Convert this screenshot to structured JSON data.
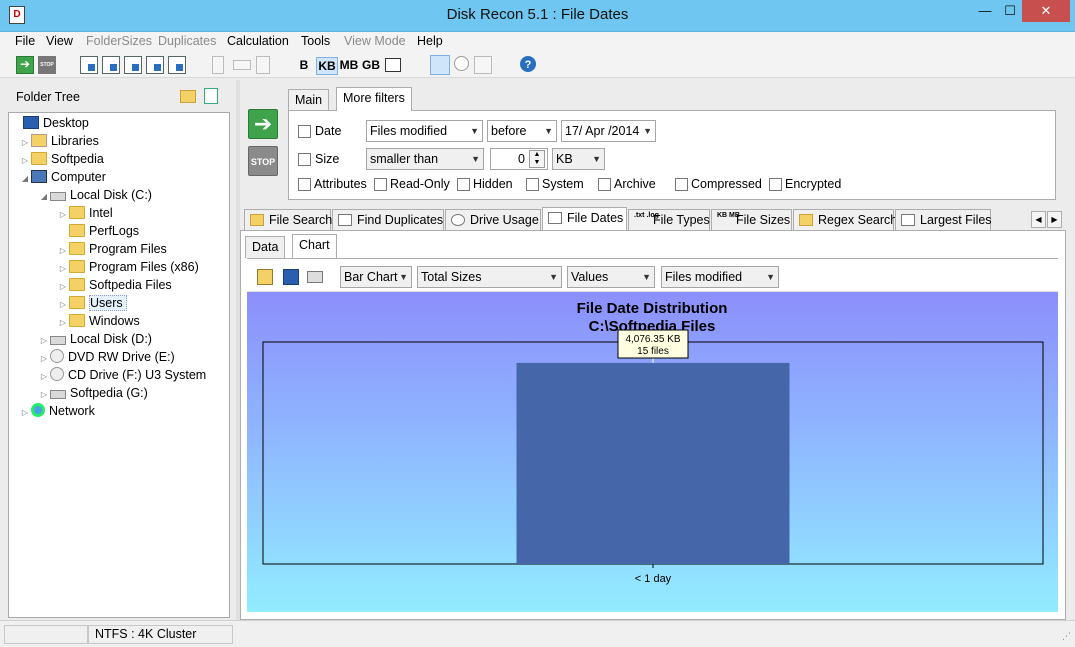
{
  "window": {
    "title": "Disk Recon 5.1 : File Dates",
    "minimize": "—",
    "maximize": "☐",
    "close": "✕"
  },
  "menu": [
    {
      "label": "File",
      "disabled": false
    },
    {
      "label": "View",
      "disabled": false
    },
    {
      "label": "FolderSizes",
      "disabled": true
    },
    {
      "label": "Duplicates",
      "disabled": true
    },
    {
      "label": "Calculation",
      "disabled": false
    },
    {
      "label": "Tools",
      "disabled": false
    },
    {
      "label": "View Mode",
      "disabled": true
    },
    {
      "label": "Help",
      "disabled": false
    }
  ],
  "toolbar": {
    "size_b": "B",
    "size_kb": "KB",
    "size_mb": "MB",
    "size_gb": "GB",
    "stop_small": "STOP"
  },
  "folder_tree": {
    "header": "Folder Tree",
    "nodes": [
      {
        "label": "Desktop",
        "icon": "desktop-icon"
      },
      {
        "label": "Libraries",
        "icon": "libraries-icon"
      },
      {
        "label": "Softpedia",
        "icon": "user-folder-icon"
      },
      {
        "label": "Computer",
        "icon": "computer-icon"
      },
      {
        "label": "Local Disk (C:)",
        "icon": "disk-icon"
      },
      {
        "label": "Intel",
        "icon": "folder-icon"
      },
      {
        "label": "PerfLogs",
        "icon": "folder-icon"
      },
      {
        "label": "Program Files",
        "icon": "folder-icon"
      },
      {
        "label": "Program Files (x86)",
        "icon": "folder-icon"
      },
      {
        "label": "Softpedia Files",
        "icon": "folder-icon"
      },
      {
        "label": "Users",
        "icon": "folder-icon"
      },
      {
        "label": "Windows",
        "icon": "folder-icon"
      },
      {
        "label": "Local Disk (D:)",
        "icon": "disk-icon"
      },
      {
        "label": "DVD RW Drive (E:)",
        "icon": "dvd-icon"
      },
      {
        "label": "CD Drive (F:) U3 System",
        "icon": "cd-icon"
      },
      {
        "label": "Softpedia (G:)",
        "icon": "usb-drive-icon"
      },
      {
        "label": "Network",
        "icon": "network-icon"
      }
    ]
  },
  "actions": {
    "go_arrow": "➔",
    "stop_label": "STOP"
  },
  "filter_tabs": [
    "Main",
    "More filters"
  ],
  "filters": {
    "date_label": "Date",
    "date_mode": "Files modified",
    "date_relation": "before",
    "date_value": "17/ Apr /2014",
    "size_label": "Size",
    "size_relation": "smaller than",
    "size_value": "0",
    "size_unit": "KB",
    "attributes_label": "Attributes",
    "attributes": [
      "Read-Only",
      "Hidden",
      "System",
      "Archive",
      "Compressed",
      "Encrypted"
    ]
  },
  "main_tabs": [
    {
      "label": "File Search"
    },
    {
      "label": "Find Duplicates"
    },
    {
      "label": "Drive Usage"
    },
    {
      "label": "File Dates"
    },
    {
      "label": "File Types",
      "icon_text": ".txt .log"
    },
    {
      "label": "File Sizes",
      "icon_text": "KB MB"
    },
    {
      "label": "Regex Search"
    },
    {
      "label": "Largest Files"
    }
  ],
  "sub_tabs": [
    "Data",
    "Chart"
  ],
  "chart_options": {
    "chart_type": "Bar Chart",
    "measure": "Total Sizes",
    "display": "Values",
    "date_mode": "Files modified"
  },
  "chart_data": {
    "type": "bar",
    "title": "File Date Distribution",
    "subtitle": "C:\\Softpedia Files",
    "categories": [
      "< 1 day"
    ],
    "values": [
      4076.35
    ],
    "unit": "KB",
    "file_counts": [
      15
    ],
    "ylim": [
      0,
      4500
    ],
    "grid": false,
    "tooltip": {
      "value_text": "4,076.35 KB",
      "count_text": "15 files"
    },
    "colors": {
      "bar": "#4566a8",
      "plot_border": "#000000"
    }
  },
  "status": {
    "fs_info": "NTFS : 4K Cluster"
  }
}
